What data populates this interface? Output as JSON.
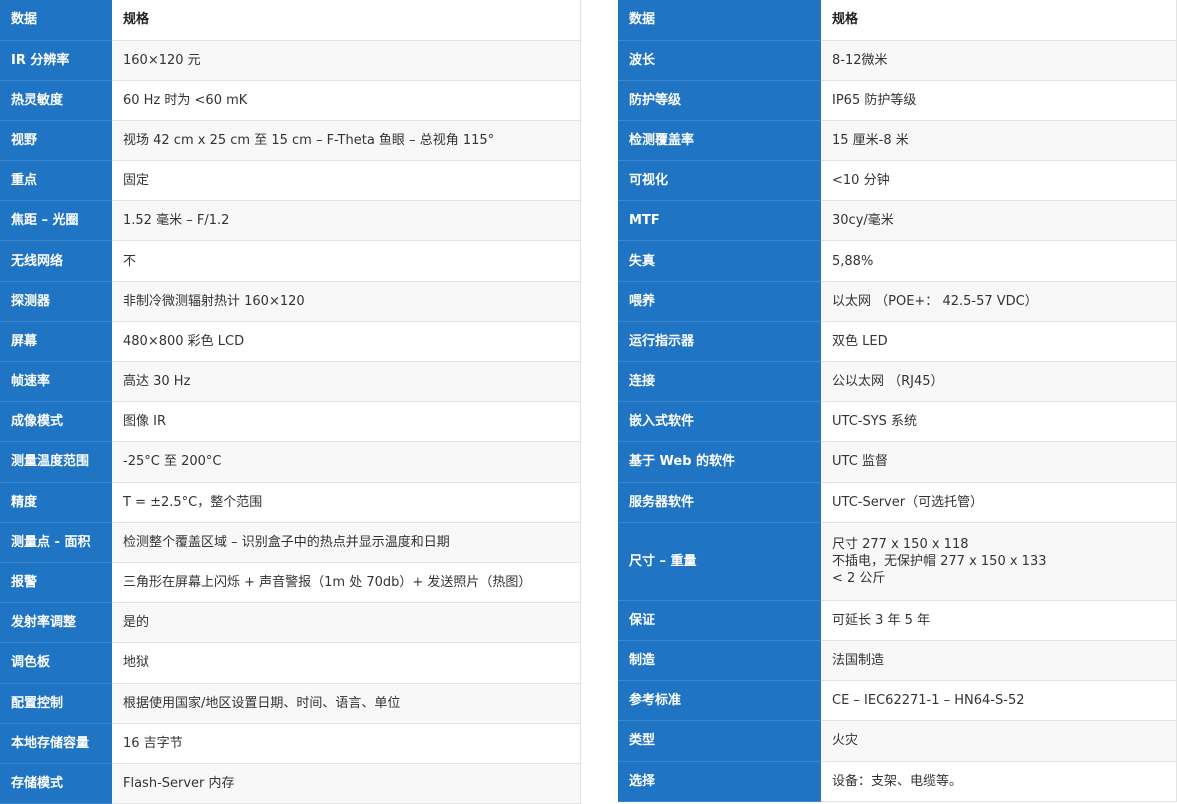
{
  "left_table": {
    "header": {
      "key": "数据",
      "value": "规格"
    },
    "rows": [
      {
        "key": "IR 分辨率",
        "value": "160×120 元"
      },
      {
        "key": "热灵敏度",
        "value": "60 Hz 时为 <60 mK"
      },
      {
        "key": "视野",
        "value": "视场 42 cm x 25 cm 至 15 cm – F-Theta 鱼眼 – 总视角 115°"
      },
      {
        "key": "重点",
        "value": "固定"
      },
      {
        "key": "焦距 – 光圈",
        "value": "1.52 毫米 – F/1.2"
      },
      {
        "key": "无线网络",
        "value": "不"
      },
      {
        "key": "探测器",
        "value": "非制冷微测辐射热计 160×120"
      },
      {
        "key": "屏幕",
        "value": "480×800 彩色 LCD"
      },
      {
        "key": "帧速率",
        "value": "高达 30 Hz"
      },
      {
        "key": "成像模式",
        "value": "图像 IR"
      },
      {
        "key": "测量温度范围",
        "value": "-25°C 至 200°C"
      },
      {
        "key": "精度",
        "value": "T = ±2.5°C，整个范围"
      },
      {
        "key": "测量点 - 面积",
        "value": "检测整个覆盖区域 – 识别盒子中的热点并显示温度和日期"
      },
      {
        "key": "报警",
        "value": "三角形在屏幕上闪烁 + 声音警报（1m 处 70db）+ 发送照片（热图）"
      },
      {
        "key": "发射率调整",
        "value": "是的"
      },
      {
        "key": "调色板",
        "value": "地狱"
      },
      {
        "key": "配置控制",
        "value": "根据使用国家/地区设置日期、时间、语言、单位"
      },
      {
        "key": "本地存储容量",
        "value": "16 吉字节"
      },
      {
        "key": "存储模式",
        "value": "Flash-Server 内存"
      }
    ]
  },
  "right_table": {
    "header": {
      "key": "数据",
      "value": "规格"
    },
    "rows": [
      {
        "key": "波长",
        "value": "8-12微米"
      },
      {
        "key": "防护等级",
        "value": "IP65 防护等级"
      },
      {
        "key": "检测覆盖率",
        "value": "15 厘米-8 米"
      },
      {
        "key": "可视化",
        "value": "<10 分钟"
      },
      {
        "key": "MTF",
        "value": "30cy/毫米"
      },
      {
        "key": "失真",
        "value": "5,88%"
      },
      {
        "key": "喂养",
        "value": "以太网 （POE+： 42.5-57 VDC）"
      },
      {
        "key": "运行指示器",
        "value": "双色 LED"
      },
      {
        "key": "连接",
        "value": "公以太网 （RJ45）"
      },
      {
        "key": "嵌入式软件",
        "value": "UTC-SYS 系统"
      },
      {
        "key": "基于 Web 的软件",
        "value": "UTC 监督"
      },
      {
        "key": "服务器软件",
        "value": "UTC-Server（可选托管）"
      },
      {
        "key": "尺寸 – 重量",
        "value_lines": [
          "尺寸 277 x 150 x 118",
          "不插电，无保护帽 277 x 150 x 133",
          "< 2 公斤"
        ]
      },
      {
        "key": "保证",
        "value": "可延长 3 年 5 年"
      },
      {
        "key": "制造",
        "value": "法国制造"
      },
      {
        "key": "参考标准",
        "value": "CE – IEC62271-1 – HN64-S-52"
      },
      {
        "key": "类型",
        "value": "火灾"
      },
      {
        "key": "选择",
        "value": "设备：支架、电缆等。"
      }
    ]
  }
}
